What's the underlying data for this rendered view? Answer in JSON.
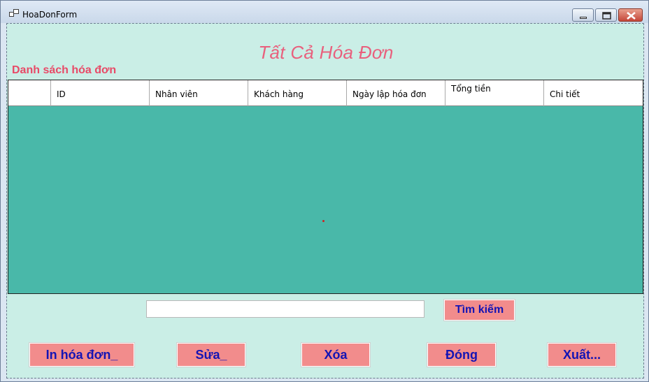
{
  "window": {
    "title": "HoaDonForm",
    "controls": [
      "minimize-icon",
      "maximize-icon",
      "close-icon"
    ]
  },
  "form": {
    "heading": "Tất Cả Hóa Đơn",
    "list_label": "Danh sách hóa đơn"
  },
  "grid": {
    "columns": [
      "",
      "ID",
      "Nhân viên",
      "Khách hàng",
      "Ngày lập hóa đơn",
      "Tổng tiền",
      "Chi tiết"
    ],
    "rows": []
  },
  "search": {
    "value": "",
    "placeholder": "",
    "button_label": "Tìm kiếm"
  },
  "actions": {
    "print": "In hóa đơn_",
    "edit": "Sửa_",
    "delete": "Xóa",
    "close": "Đóng",
    "export": "Xuất..."
  },
  "colors": {
    "heading": "#e9607d",
    "label": "#e84a67",
    "button_bg": "#f28c8c",
    "button_text": "#1414b4",
    "client_bg": "#caeee6",
    "grid_bg": "#49b8a9"
  }
}
